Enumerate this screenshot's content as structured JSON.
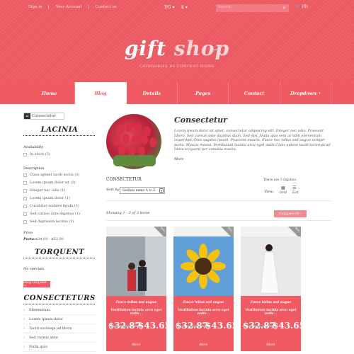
{
  "top": {
    "links": [
      "Sign in",
      "Your Account",
      "Contact us"
    ],
    "currency": "DG",
    "currency2": "$",
    "search_placeholder": "Search...",
    "cart": "(0)"
  },
  "logo": {
    "gift": "gift",
    "shop": "shop"
  },
  "tagline": "CATEGORIES DE CONTENT ICONS",
  "nav": [
    "Home",
    "Blog",
    "Details",
    "Pages",
    "Contact",
    "Dropdown"
  ],
  "breadcrumb": "Consectetur",
  "sidebar": {
    "head1": "LACINIA",
    "availability_label": "Availability",
    "availability": "In stock (5)",
    "description_label": "Description",
    "descriptions": [
      "Class aptent taciti sociis (1)",
      "Lorem ipsum dolor sit (1)",
      "Integer nec odio (1)",
      "Lorem ipsum dolor (1)",
      "Curabitur sodales ligula (1)",
      "Sed cursus ante dapibus (1)",
      "Sed dignissim lacinia (1)"
    ],
    "price_label": "Price",
    "price_prefix": "Porta:",
    "price_range": "$34.00 - $52.00",
    "head2": "TORQUENT",
    "no_specials": "No specials",
    "all_specials": "Shop torquent →",
    "head3": "CONSECTETURS",
    "cats": [
      "Elementum",
      "Lorem ipsum dolor",
      "Taciti sociosqu ad litora",
      "Sed cursus ante",
      "Nulla quis"
    ]
  },
  "product": {
    "title": "Consectetur",
    "desc": "Lorem ipsum dolor sit amet, consectetur adipiscing elit. Integer nec odio. Praesent libero. Sed cursus ante dapibus diam. Sed nisi. Nulla quis sem at nibh elementum imperdiet. Duis sagittis ipsum. Praesent mauris. Fusce nec tellus sed augue semper porta. Mauris massa. Vestibulum lacinia arcu eget nulla.Class aptent taciti sociosqu ad litora torquent per conubia nostra.",
    "more": "More"
  },
  "listing": {
    "section_title": "CONSECTETUR",
    "showing": "There are 3 dapibus.",
    "sort_label": "Sort by",
    "sort_value": "Dolibus name A to Z",
    "view_label": "View:",
    "grid": "Grid",
    "list": "List",
    "count": "Showing 1 - 3 of 3 items",
    "compare": "Compare (0) ›"
  },
  "cards": [
    {
      "ribbon": "New",
      "name": "Fusce tellus sed augue",
      "desc": "Vestibulum lacinia arcu eget nulla...",
      "old": "$32.87",
      "new": "$43.65",
      "more": "More"
    },
    {
      "ribbon": "New",
      "name": "Fusce tellus sed augue",
      "desc": "Vestibulum lacinia arcu eget nulla...",
      "old": "$32.87",
      "new": "$43.65",
      "more": "More"
    },
    {
      "ribbon": "New",
      "name": "Fusce tellus sed augue",
      "desc": "Vestibulum lacinia arcu eget nulla...",
      "old": "$32.87",
      "new": "$43.65",
      "more": "More"
    }
  ],
  "colors": {
    "accent": "#ef5a63"
  }
}
